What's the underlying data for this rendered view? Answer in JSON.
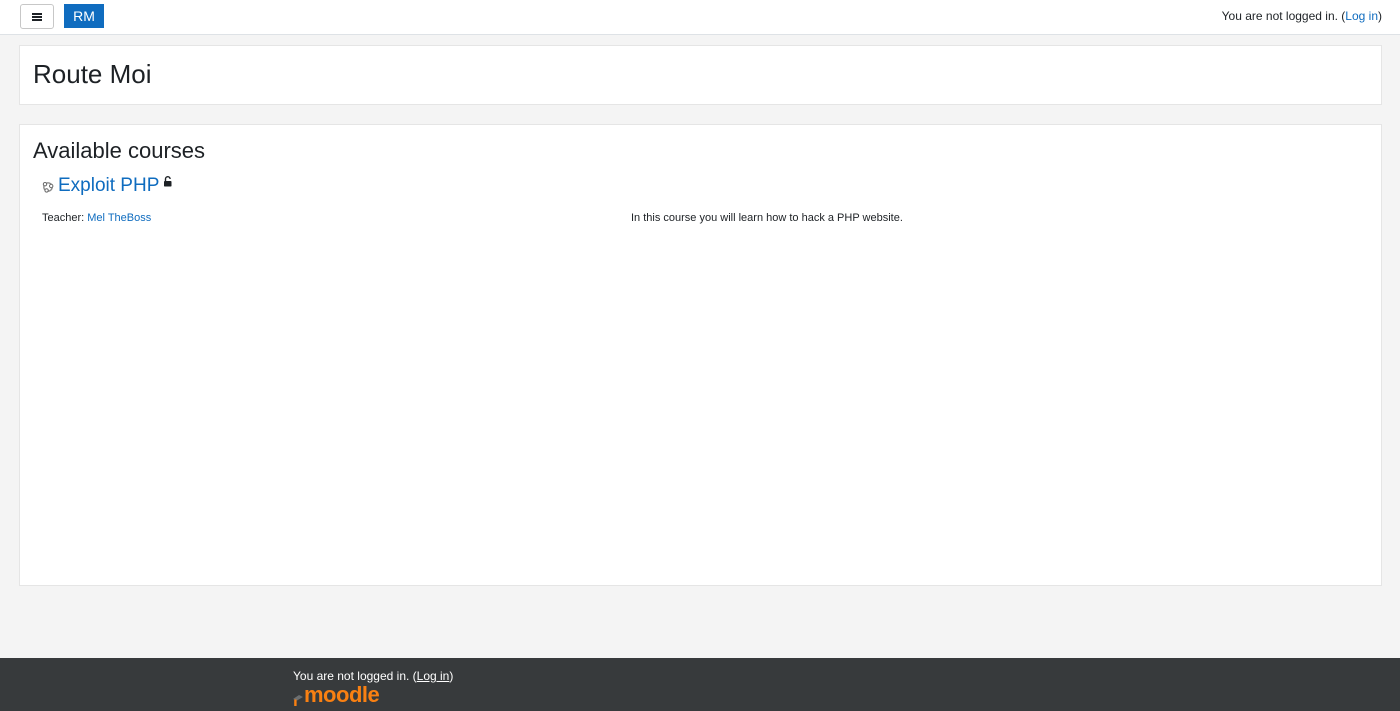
{
  "navbar": {
    "brand_label": "RM",
    "login_prefix": "You are not logged in. (",
    "login_link": "Log in",
    "login_suffix": ")"
  },
  "header": {
    "title": "Route Moi"
  },
  "main": {
    "section_title": "Available courses",
    "courses": [
      {
        "name": "Exploit PHP",
        "teacher_label": "Teacher: ",
        "teacher_name": "Mel TheBoss",
        "summary": "In this course you will learn how to hack a PHP website."
      }
    ]
  },
  "footer": {
    "login_prefix": "You are not logged in. (",
    "login_link": "Log in",
    "login_suffix": ")",
    "logo_text": "moodle"
  },
  "colors": {
    "brand": "#0f6cbf",
    "footer_bg": "#373a3c",
    "moodle_orange": "#f98012"
  },
  "icons": {
    "menu": "hamburger-icon",
    "course": "course-icon",
    "lock": "unlock-icon",
    "logo": "moodle-hat-icon"
  }
}
